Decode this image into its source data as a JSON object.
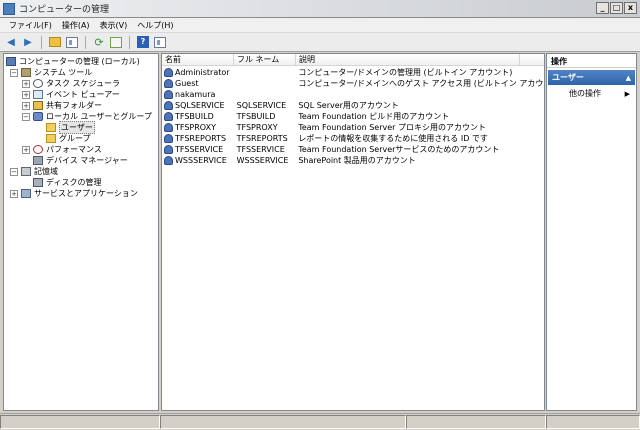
{
  "window": {
    "title": "コンピューターの管理"
  },
  "menu": [
    "ファイル(F)",
    "操作(A)",
    "表示(V)",
    "ヘルプ(H)"
  ],
  "tree": {
    "root": "コンピューターの管理 (ローカル)",
    "system_tools": "システム ツール",
    "task_scheduler": "タスク スケジューラ",
    "event_viewer": "イベント ビューアー",
    "shared_folders": "共有フォルダー",
    "local_users_groups": "ローカル ユーザーとグループ",
    "users": "ユーザー",
    "groups": "グループ",
    "performance": "パフォーマンス",
    "device_manager": "デバイス マネージャー",
    "storage": "記憶域",
    "disk_management": "ディスクの管理",
    "services_apps": "サービスとアプリケーション"
  },
  "list": {
    "columns": [
      "名前",
      "フル ネーム",
      "説明"
    ],
    "rows": [
      {
        "name": "Administrator",
        "full": "",
        "desc": "コンピューター/ドメインの管理用 (ビルトイン アカウント)"
      },
      {
        "name": "Guest",
        "full": "",
        "desc": "コンピューター/ドメインへのゲスト アクセス用 (ビルトイン アカウント)"
      },
      {
        "name": "nakamura",
        "full": "",
        "desc": ""
      },
      {
        "name": "SQLSERVICE",
        "full": "SQLSERVICE",
        "desc": "SQL Server用のアカウント"
      },
      {
        "name": "TFSBUILD",
        "full": "TFSBUILD",
        "desc": "Team Foundation ビルド用のアカウント"
      },
      {
        "name": "TFSPROXY",
        "full": "TFSPROXY",
        "desc": "Team Foundation Server プロキシ用のアカウント"
      },
      {
        "name": "TFSREPORTS",
        "full": "TFSREPORTS",
        "desc": "レポートの情報を収集するために使用される ID です"
      },
      {
        "name": "TFSSERVICE",
        "full": "TFSSERVICE",
        "desc": "Team Foundation Serverサービスのためのアカウント"
      },
      {
        "name": "WSSSERVICE",
        "full": "WSSSERVICE",
        "desc": "SharePoint 製品用のアカウント"
      }
    ]
  },
  "actions": {
    "title": "操作",
    "section": "ユーザー",
    "more": "他の操作"
  },
  "icons": {
    "back": "back-arrow-icon",
    "forward": "forward-arrow-icon",
    "up": "folder-up-icon",
    "show_hide": "console-tree-icon",
    "refresh": "refresh-icon",
    "export": "export-list-icon",
    "help": "help-icon",
    "action_pane": "action-pane-icon"
  },
  "colors": {
    "accent": "#2f64a8",
    "selected": "#e6e6e6"
  }
}
